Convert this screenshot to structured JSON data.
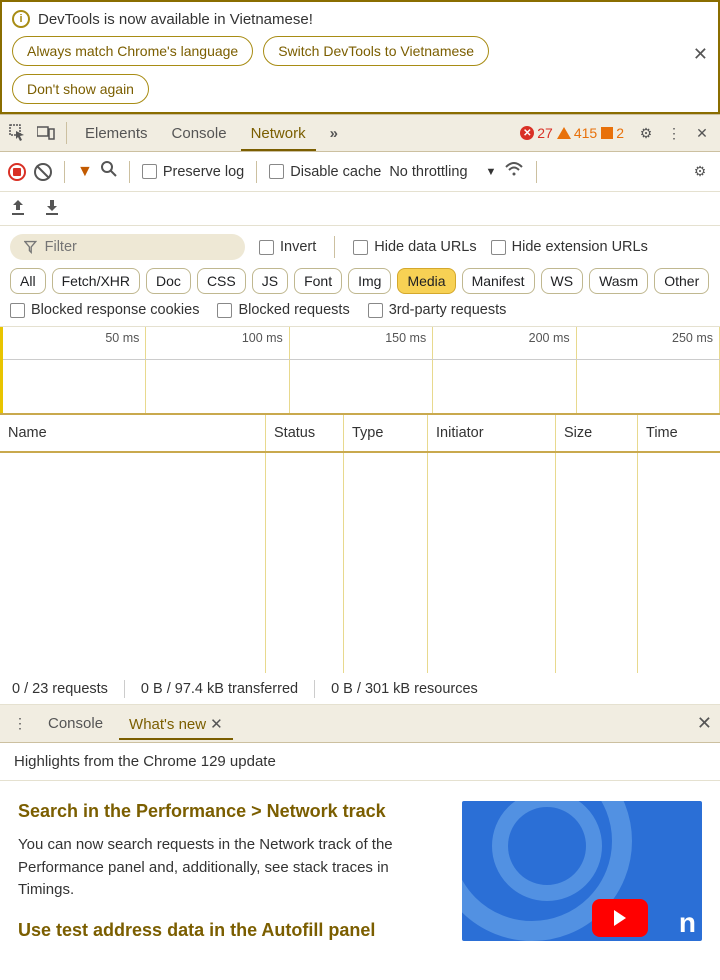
{
  "banner": {
    "title": "DevTools is now available in Vietnamese!",
    "btn_match": "Always match Chrome's language",
    "btn_switch": "Switch DevTools to Vietnamese",
    "btn_dont": "Don't show again"
  },
  "toolbar": {
    "tabs": {
      "elements": "Elements",
      "console": "Console",
      "network": "Network"
    },
    "more": "»",
    "errors": "27",
    "warnings": "415",
    "issues": "2"
  },
  "net": {
    "preserve": "Preserve log",
    "disable_cache": "Disable cache",
    "throttle": "No throttling"
  },
  "filter": {
    "placeholder": "Filter",
    "invert": "Invert",
    "hide_data": "Hide data URLs",
    "hide_ext": "Hide extension URLs",
    "pills": [
      "All",
      "Fetch/XHR",
      "Doc",
      "CSS",
      "JS",
      "Font",
      "Img",
      "Media",
      "Manifest",
      "WS",
      "Wasm",
      "Other"
    ],
    "active_pill": "Media",
    "blocked_cookies": "Blocked response cookies",
    "blocked_req": "Blocked requests",
    "third_party": "3rd-party requests"
  },
  "timeline": {
    "labels": [
      "50 ms",
      "100 ms",
      "150 ms",
      "200 ms",
      "250 ms"
    ]
  },
  "table": {
    "cols": {
      "name": "Name",
      "status": "Status",
      "type": "Type",
      "initiator": "Initiator",
      "size": "Size",
      "time": "Time"
    }
  },
  "status": {
    "requests": "0 / 23 requests",
    "transferred": "0 B / 97.4 kB transferred",
    "resources": "0 B / 301 kB resources"
  },
  "drawer": {
    "console": "Console",
    "whatsnew": "What's new",
    "subtitle": "Highlights from the Chrome 129 update",
    "h1": "Search in the Performance > Network track",
    "p1": "You can now search requests in the Network track of the Performance panel and, additionally, see stack traces in Timings.",
    "h2": "Use test address data in the Autofill panel"
  }
}
